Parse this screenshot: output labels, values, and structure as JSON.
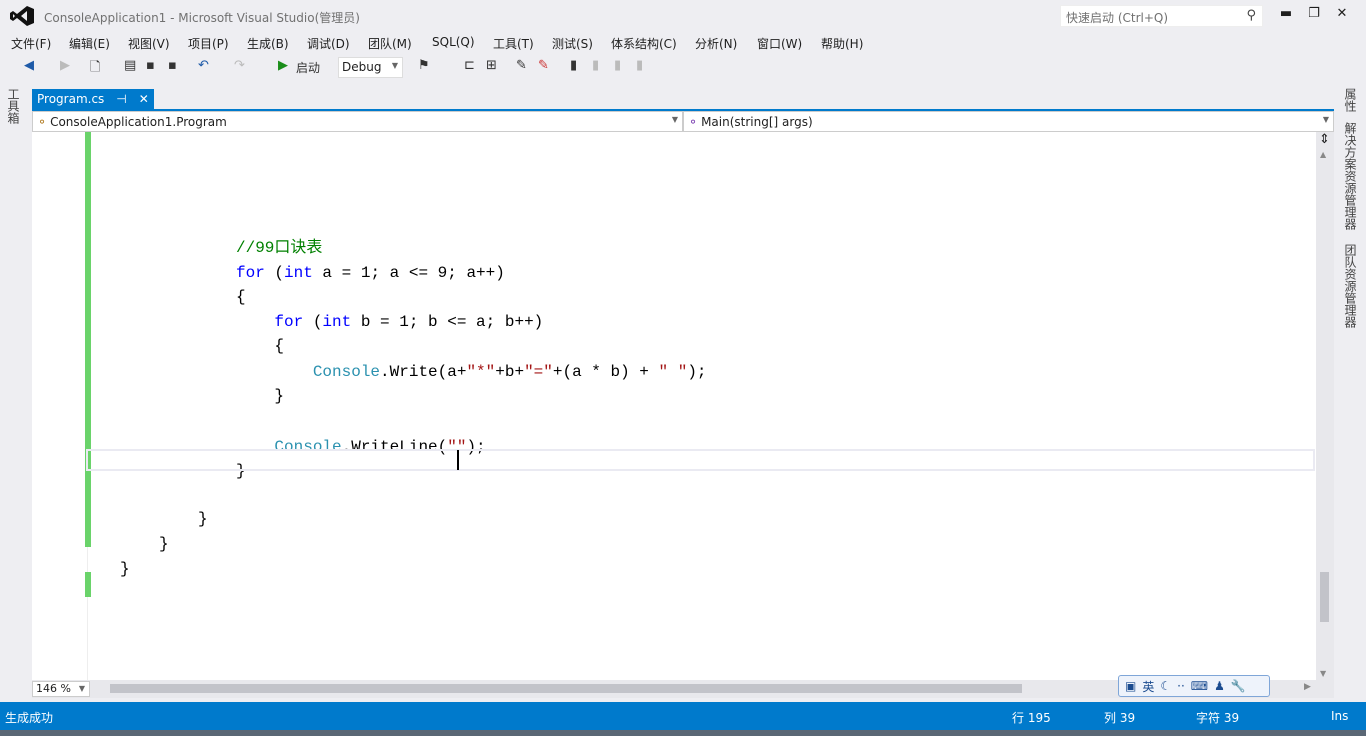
{
  "window": {
    "title": "ConsoleApplication1 - Microsoft Visual Studio(管理员)",
    "quick_launch_placeholder": "快速启动 (Ctrl+Q)"
  },
  "menu": [
    "文件(F)",
    "编辑(E)",
    "视图(V)",
    "项目(P)",
    "生成(B)",
    "调试(D)",
    "团队(M)",
    "SQL(Q)",
    "工具(T)",
    "测试(S)",
    "体系结构(C)",
    "分析(N)",
    "窗口(W)",
    "帮助(H)"
  ],
  "toolbar": {
    "start_label": "启动",
    "config": "Debug"
  },
  "toolbox_label": "工具箱",
  "tab": {
    "label": "Program.cs",
    "pin": "⊣",
    "close": "✕"
  },
  "nav": {
    "class_selector": "ConsoleApplication1.Program",
    "member_selector": "Main(string[] args)"
  },
  "code": [
    [
      [
        "//99口诀表",
        "cmt"
      ]
    ],
    [
      [
        "for",
        "kw"
      ],
      [
        " (",
        "txt"
      ],
      [
        "int",
        "kw"
      ],
      [
        " a = 1; a <= 9; a++)",
        "txt"
      ]
    ],
    [
      [
        "{",
        "txt"
      ]
    ],
    [
      [
        "    ",
        "txt"
      ],
      [
        "for",
        "kw"
      ],
      [
        " (",
        "txt"
      ],
      [
        "int",
        "kw"
      ],
      [
        " b = 1; b <= a; b++)",
        "txt"
      ]
    ],
    [
      [
        "    {",
        "txt"
      ]
    ],
    [
      [
        "        ",
        "txt"
      ],
      [
        "Console",
        "cls"
      ],
      [
        ".Write(a+",
        "txt"
      ],
      [
        "\"*\"",
        "str"
      ],
      [
        "+b+",
        "txt"
      ],
      [
        "\"=\"",
        "str"
      ],
      [
        "+(a * b) + ",
        "txt"
      ],
      [
        "\" \"",
        "str"
      ],
      [
        ");",
        "txt"
      ]
    ],
    [
      [
        "    }",
        "txt"
      ]
    ],
    [
      [
        "",
        "txt"
      ]
    ],
    [
      [
        "    ",
        "txt"
      ],
      [
        "Console",
        "cls"
      ],
      [
        ".WriteLine(",
        "txt"
      ],
      [
        "\"\"",
        "str"
      ],
      [
        ");",
        "txt"
      ]
    ],
    [
      [
        "}",
        "txt"
      ]
    ],
    [
      [
        "",
        "txt"
      ]
    ],
    [
      [
        "}",
        "txt"
      ]
    ],
    [
      [
        "}",
        "txt"
      ]
    ],
    [
      [
        "}",
        "txt"
      ]
    ]
  ],
  "zoom_level": "146 %",
  "ime": {
    "lang": "英"
  },
  "right_tabs": [
    "属性",
    "解决方案资源管理器",
    "团队资源管理器"
  ],
  "status": {
    "message": "生成成功",
    "row": "行 195",
    "col": "列 39",
    "char": "字符 39",
    "mode": "Ins"
  }
}
